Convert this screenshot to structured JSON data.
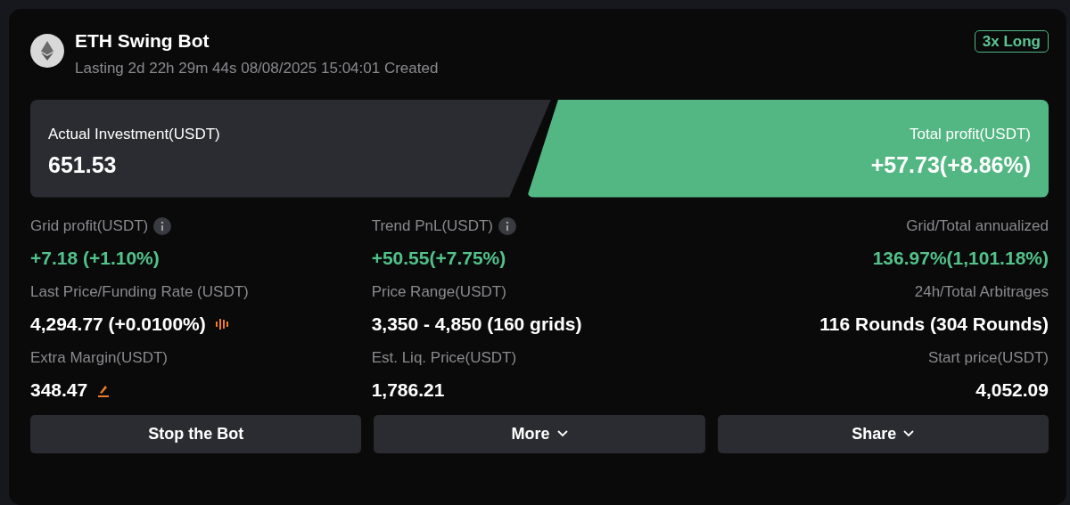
{
  "bot": {
    "name": "ETH Swing Bot",
    "subtitle": "Lasting 2d 22h 29m 44s 08/08/2025 15:04:01 Created",
    "badge": "3x Long"
  },
  "investment": {
    "label": "Actual Investment(USDT)",
    "value": "651.53"
  },
  "total_profit": {
    "label": "Total profit(USDT)",
    "value": "+57.73(+8.86%)"
  },
  "stats": [
    {
      "kind": "info",
      "label": "Grid profit(USDT)",
      "value": "+7.18 (+1.10%)",
      "color": "#52c28a"
    },
    {
      "kind": "info",
      "label": "Trend PnL(USDT)",
      "value": "+50.55(+7.75%)",
      "color": "#52c28a"
    },
    {
      "kind": "plain",
      "label": "Grid/Total annualized",
      "value": "136.97%(1,101.18%)",
      "color": "#52c28a"
    },
    {
      "kind": "funding",
      "label": "Last Price/Funding Rate (USDT)",
      "value": "4,294.77 (+0.0100%)",
      "color": "#ffffff"
    },
    {
      "kind": "plain",
      "label": "Price Range(USDT)",
      "value": "3,350 - 4,850 (160 grids)",
      "color": "#ffffff"
    },
    {
      "kind": "plain",
      "label": "24h/Total Arbitrages",
      "value": "116 Rounds (304 Rounds)",
      "color": "#ffffff"
    },
    {
      "kind": "editable",
      "label": "Extra Margin(USDT)",
      "value": "348.47",
      "color": "#ffffff"
    },
    {
      "kind": "plain",
      "label": "Est. Liq. Price(USDT)",
      "value": "1,786.21",
      "color": "#ffffff"
    },
    {
      "kind": "plain",
      "label": "Start price(USDT)",
      "value": "4,052.09",
      "color": "#ffffff"
    }
  ],
  "buttons": [
    {
      "label": "Stop the Bot",
      "dropdown": false
    },
    {
      "label": "More",
      "dropdown": true
    },
    {
      "label": "Share",
      "dropdown": true
    }
  ]
}
